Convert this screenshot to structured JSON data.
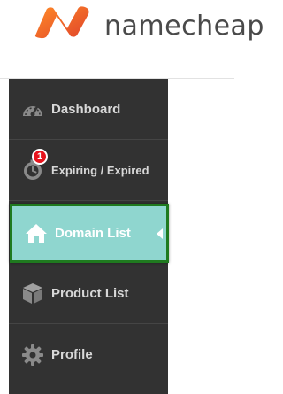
{
  "brand": {
    "name": "namecheap",
    "logo_icon": "namecheap-n-logo",
    "colors": {
      "logo_gradient_start": "#ff8a28",
      "logo_gradient_end": "#e0442a",
      "logo_text": "#4a4a4a"
    }
  },
  "sidebar": {
    "background": "#323232",
    "active_background": "#8fd6cf",
    "active_border": "#1f7a1f",
    "items": [
      {
        "label": "Dashboard",
        "icon": "speedometer-icon",
        "active": false
      },
      {
        "label": "Expiring / Expired",
        "icon": "stopwatch-icon",
        "active": false,
        "badge": "1"
      },
      {
        "label": "Domain List",
        "icon": "home-icon",
        "active": true
      },
      {
        "label": "Product List",
        "icon": "box-icon",
        "active": false
      },
      {
        "label": "Profile",
        "icon": "gear-icon",
        "active": false
      }
    ]
  }
}
